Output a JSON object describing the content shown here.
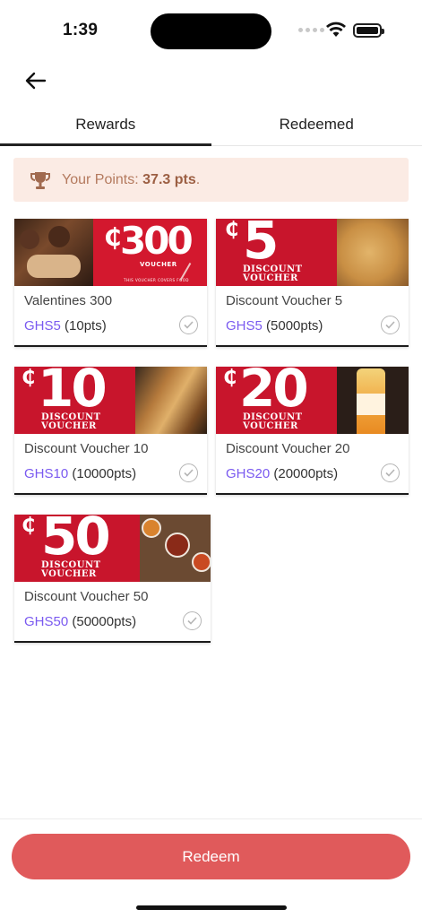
{
  "status_bar": {
    "time": "1:39"
  },
  "tabs": [
    {
      "label": "Rewards",
      "active": true
    },
    {
      "label": "Redeemed",
      "active": false
    }
  ],
  "points": {
    "label": "Your Points:",
    "value": "37.3 pts",
    "suffix": "."
  },
  "vouchers": [
    {
      "title": "Valentines 300",
      "cost": "GHS5",
      "points": "(10pts)",
      "image_number": "300",
      "image_caption": "VOUCHER",
      "image_footer": "THIS VOUCHER COVERS FOOD"
    },
    {
      "title": "Discount Voucher 5",
      "cost": "GHS5",
      "points": "(5000pts)",
      "image_number": "5",
      "image_caption": "DISCOUNT VOUCHER"
    },
    {
      "title": "Discount Voucher 10",
      "cost": "GHS10",
      "points": "(10000pts)",
      "image_number": "10",
      "image_caption": "DISCOUNT VOUCHER"
    },
    {
      "title": "Discount Voucher 20",
      "cost": "GHS20",
      "points": "(20000pts)",
      "image_number": "20",
      "image_caption": "DISCOUNT VOUCHER"
    },
    {
      "title": "Discount Voucher 50",
      "cost": "GHS50",
      "points": "(50000pts)",
      "image_number": "50",
      "image_caption": "DISCOUNT VOUCHER"
    }
  ],
  "currency_symbol": "₵",
  "redeem_button": {
    "label": "Redeem"
  },
  "colors": {
    "accent": "#e05a5b",
    "price": "#7a5af0",
    "banner_bg": "#fbebe4",
    "voucher_red": "#c8152c"
  }
}
